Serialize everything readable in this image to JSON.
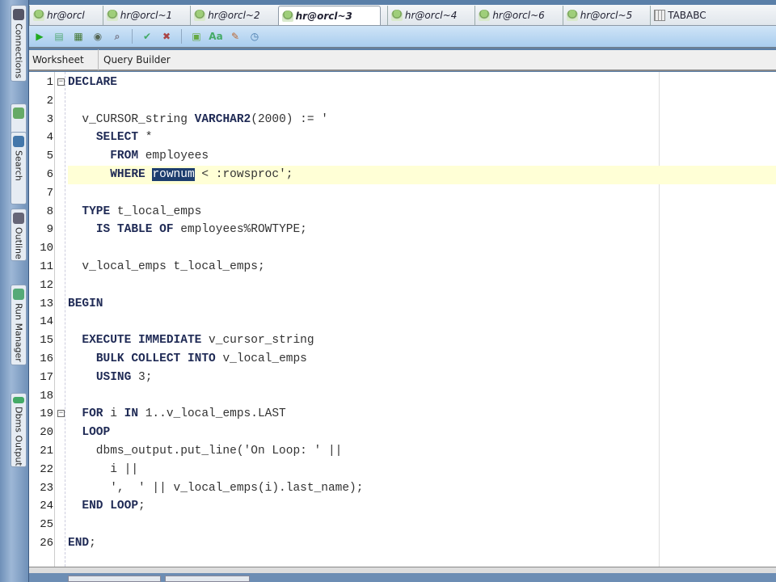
{
  "sidebar": {
    "tabs": [
      {
        "label": "Connections"
      },
      {
        "label": ""
      },
      {
        "label": "Search"
      },
      {
        "label": "Outline"
      },
      {
        "label": "Run Manager"
      },
      {
        "label": "Dbms Output"
      }
    ]
  },
  "tabs": [
    {
      "label": "hr@orcl"
    },
    {
      "label": "hr@orcl~1"
    },
    {
      "label": "hr@orcl~2"
    },
    {
      "label": "hr@orcl~3",
      "active": true
    },
    {
      "label": "hr@orcl~4"
    },
    {
      "label": "hr@orcl~6"
    },
    {
      "label": "hr@orcl~5"
    },
    {
      "label": "TABABC",
      "table": true
    }
  ],
  "toolbar": {
    "buttons": [
      "run-statement",
      "run-script",
      "autotrace",
      "explain-plan",
      "sql-tuning",
      "commit",
      "rollback",
      "unshared-sql",
      "to-upper-lower",
      "clear",
      "sql-history"
    ]
  },
  "subtabs": {
    "worksheet": "Worksheet",
    "query_builder": "Query Builder"
  },
  "editor": {
    "current_line": 6,
    "selection": {
      "line": 6,
      "text": "rownum"
    },
    "keywords": [
      "DECLARE",
      "VARCHAR2",
      "SELECT",
      "FROM",
      "WHERE",
      "TYPE",
      "IS",
      "TABLE",
      "OF",
      "BEGIN",
      "EXECUTE",
      "IMMEDIATE",
      "BULK",
      "COLLECT",
      "INTO",
      "USING",
      "FOR",
      "IN",
      "LOOP",
      "END"
    ],
    "fold_lines": [
      1,
      19
    ],
    "lines": [
      "DECLARE",
      "",
      "  v_CURSOR_string VARCHAR2(2000) := '",
      "    SELECT *",
      "      FROM employees",
      "      WHERE rownum < :rowsproc';",
      "",
      "  TYPE t_local_emps",
      "    IS TABLE OF employees%ROWTYPE;",
      "",
      "  v_local_emps t_local_emps;",
      "",
      "BEGIN",
      "",
      "  EXECUTE IMMEDIATE v_cursor_string",
      "    BULK COLLECT INTO v_local_emps",
      "    USING 3;",
      "",
      "  FOR i IN 1..v_local_emps.LAST",
      "  LOOP",
      "    dbms_output.put_line('On Loop: ' ||",
      "      i ||",
      "      ',  ' || v_local_emps(i).last_name);",
      "  END LOOP;",
      "",
      "END;"
    ]
  }
}
